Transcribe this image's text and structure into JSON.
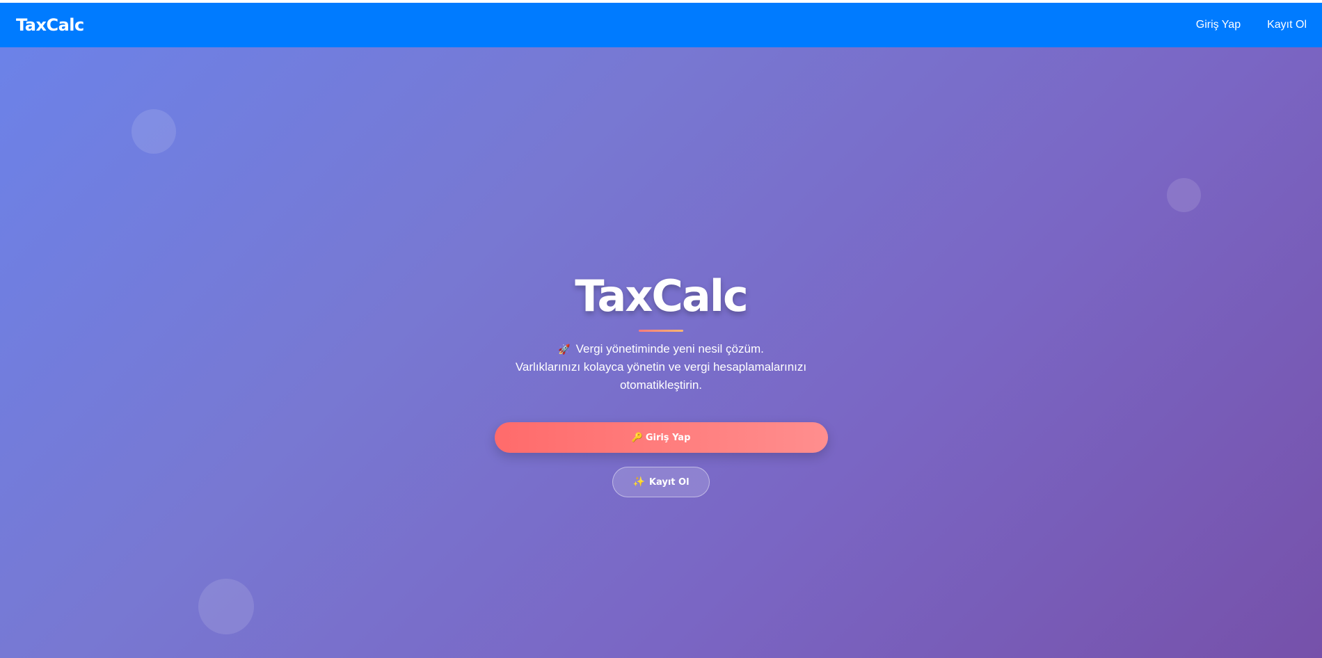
{
  "navbar": {
    "brand": "TaxCalc",
    "links": [
      {
        "label": "Giriş Yap"
      },
      {
        "label": "Kayıt Ol"
      }
    ],
    "background_color": "#007bff"
  },
  "hero": {
    "title": "TaxCalc",
    "tagline": "Vergi yönetiminde yeni nesil çözüm.",
    "tagline_icon": "rocket-icon",
    "description": "Varlıklarınızı kolayca yönetin ve vergi hesaplamalarınızı otomatikleştirin.",
    "login_button": {
      "label": "Giriş Yap",
      "icon": "key-icon",
      "color": "#ff6b6b"
    },
    "register_button": {
      "label": "Kayıt Ol",
      "icon": "sparkle-icon"
    },
    "gradient_colors": [
      "#6c82e8",
      "#7651aa"
    ]
  }
}
